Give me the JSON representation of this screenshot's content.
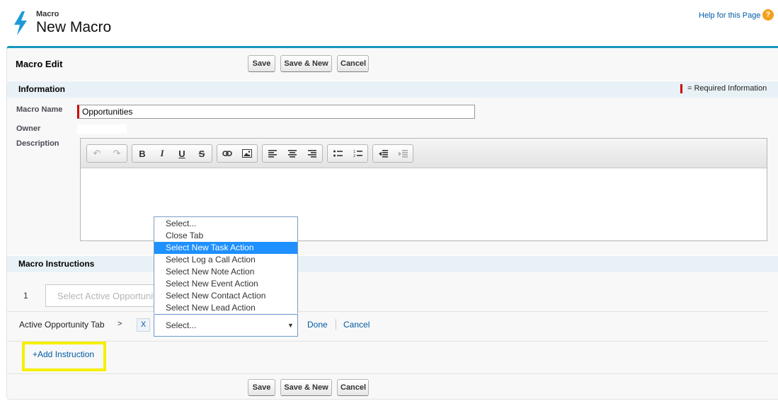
{
  "header": {
    "subtitle": "Macro",
    "title": "New Macro",
    "help_link": "Help for this Page",
    "help_icon": "?"
  },
  "toolbar": {
    "title": "Macro Edit",
    "save": "Save",
    "save_new": "Save & New",
    "cancel": "Cancel"
  },
  "information": {
    "title": "Information",
    "required_note": "= Required Information",
    "macro_name_label": "Macro Name",
    "macro_name_value": "Opportunities",
    "owner_label": "Owner",
    "description_label": "Description"
  },
  "editor_icons": [
    "undo-icon",
    "redo-icon",
    "bold-icon",
    "italic-icon",
    "underline-icon",
    "strikethrough-icon",
    "link-icon",
    "image-icon",
    "align-left-icon",
    "align-center-icon",
    "align-right-icon",
    "bulleted-list-icon",
    "numbered-list-icon",
    "outdent-icon",
    "indent-icon"
  ],
  "instructions": {
    "title": "Macro Instructions",
    "step_number": "1",
    "step_placeholder": "Select Active Opportunity Tab",
    "row_label": "Active Opportunity Tab",
    "separator": ">",
    "remove": "X",
    "select_value": "Select...",
    "done": "Done",
    "cancel": "Cancel",
    "add_instruction": "+Add Instruction",
    "dropdown_options": [
      "Select...",
      "Close Tab",
      "Select New Task Action",
      "Select Log a Call Action",
      "Select New Note Action",
      "Select New Event Action",
      "Select New Contact Action",
      "Select New Lead Action"
    ],
    "highlighted_option": "Select New Task Action"
  },
  "colors": {
    "accent": "#1797c0",
    "link": "#015ba7",
    "required": "#cc0000",
    "highlight": "#f5ef00",
    "dropdown_selected": "#1e90ff"
  }
}
